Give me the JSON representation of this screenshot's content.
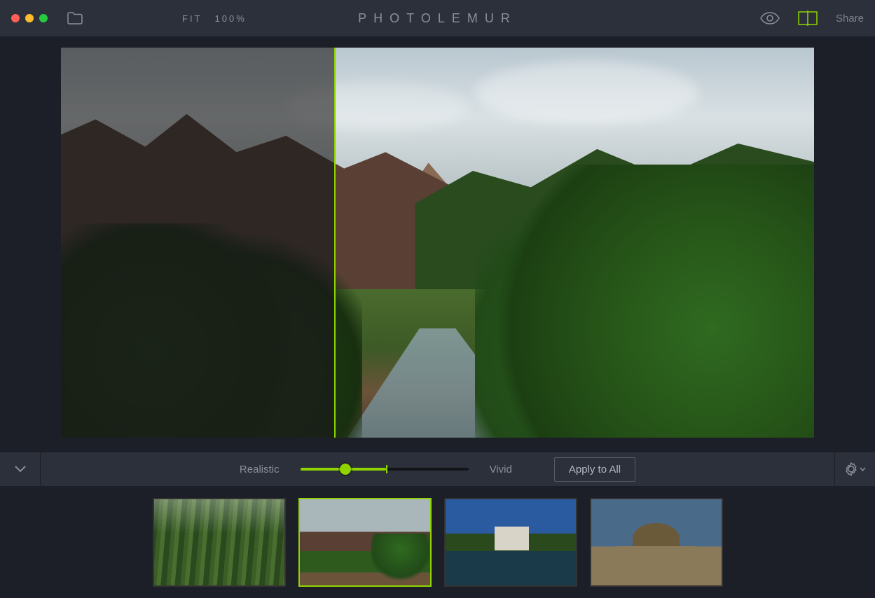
{
  "app": {
    "title": "PHOTOLEMUR"
  },
  "toolbar": {
    "fit_label": "FIT",
    "zoom_label": "100%",
    "share_label": "Share"
  },
  "compare": {
    "split_position_pct": 36.3
  },
  "styles": {
    "left_label": "Realistic",
    "right_label": "Vivid",
    "slider_value_pct": 27,
    "slider_mark_pct": 51,
    "apply_all_label": "Apply to All"
  },
  "thumbnails": [
    {
      "id": "bamboo",
      "selected": false
    },
    {
      "id": "canyon",
      "selected": true
    },
    {
      "id": "chateau",
      "selected": false
    },
    {
      "id": "dome",
      "selected": false
    }
  ],
  "colors": {
    "accent": "#8fd400",
    "panel": "#2c303b",
    "bg": "#1c1f28"
  }
}
